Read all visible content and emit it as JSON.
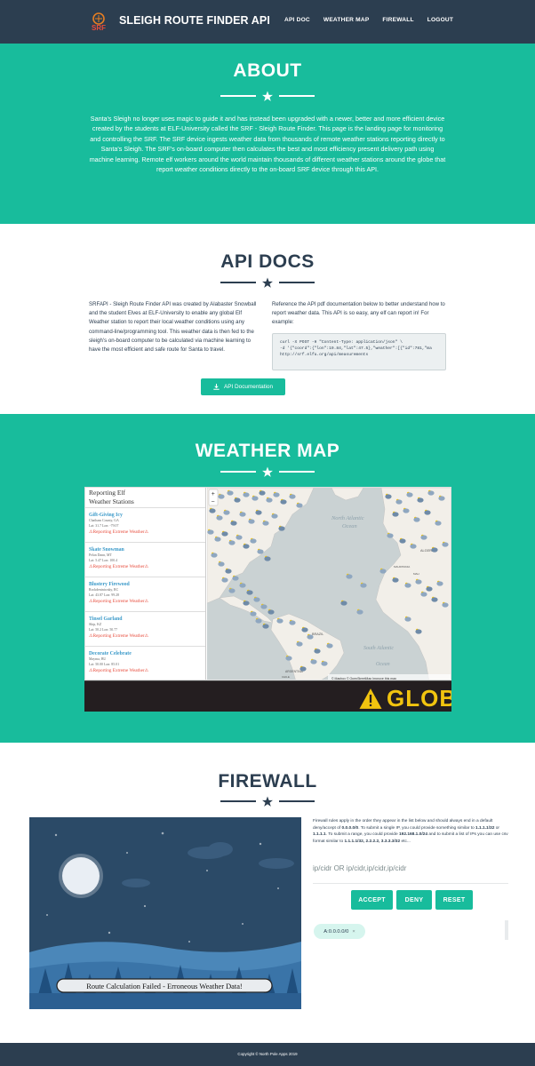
{
  "nav": {
    "brand": "SLEIGH ROUTE FINDER API",
    "logo_text": "SRF",
    "links": [
      "API DOC",
      "WEATHER MAP",
      "FIREWALL",
      "LOGOUT"
    ]
  },
  "about": {
    "title": "ABOUT",
    "text": "Santa's Sleigh no longer uses magic to guide it and has instead been upgraded with a newer, better and more efficient device created by the students at ELF-University called the SRF - Sleigh Route Finder. This page is the landing page for monitoring and controlling the SRF. The SRF device ingests weather data from thousands of remote weather stations reporting directly to Santa's Sleigh. The SRF's on-board computer then calculates the best and most efficiency present delivery path using machine learning. Remote elf workers around the world maintain thousands of different weather stations around the globe that report weather conditions directly to the on-board SRF device through this API."
  },
  "api_docs": {
    "title": "API DOCS",
    "left_text": "SRFAPI - Sleigh Route Finder API was created by Alabaster Snowball and the student Elves at ELF-University to enable any global Elf Weather station to report their local weather conditions using any command-line/programming tool. This weather data is then fed to the sleigh's on-board computer to be calculated via machine learning to have the most efficient and safe route for Santa to travel.",
    "right_text": "Reference the API pdf documentation below to better understand how to report weather data. This API is so easy, any elf can report in! For example:",
    "code_line1": "curl -X POST -H \"Content-Type: application/json\" \\",
    "code_line2": "-d '{\"coord\":{\"lon\":19.84,\"lat\":47.5},\"weather\":[{\"id\":781,\"ma",
    "code_line3": "http://srf.elfu.org/api/measurements",
    "button": "API Documentation"
  },
  "weather": {
    "title": "WEATHER MAP",
    "panel_title_1": "Reporting Elf",
    "panel_title_2": "Weather Stations",
    "stations": [
      {
        "name": "Gift-Giving Icy",
        "loc": "Chatham County, GA",
        "ll": "Lat: 31.7 Lon: -79.07",
        "warn": "⚠Reporting Extreme Weather⚠"
      },
      {
        "name": "Skate Snowman",
        "loc": "Pelan Dann, MT",
        "ll": "Lat: 5.47 Lon: 100.4",
        "warn": "⚠Reporting Extreme Weather⚠"
      },
      {
        "name": "Blustery Firewood",
        "loc": "Rockdeniniwaky, RC",
        "ll": "Lat: 43.87 Lon: 99.28",
        "warn": "⚠Reporting Extreme Weather⚠"
      },
      {
        "name": "Tinsel Garland",
        "loc": "Skip, KZ",
        "ll": "Lat: 50.2 Lon: 50.77",
        "warn": "⚠Reporting Extreme Weather⚠"
      },
      {
        "name": "Decorate Celebrate",
        "loc": "Mayma, BU",
        "ll": "Lat: 50.00 Lon: 85.01",
        "warn": "⚠Reporting Extreme Weather⚠"
      }
    ],
    "map_labels": {
      "ocean1_a": "North Atlantic",
      "ocean1_b": "Ocean",
      "ocean2_a": "South Atlantic",
      "ocean2_b": "Ocean",
      "algeria": "ALGERIA",
      "brazil": "BRAZIL",
      "argentina": "ARGENTINA",
      "chile": "CHILE",
      "mauritania": "MAURITANIA",
      "mali": "MALI",
      "attribution": "© Mapbox © OpenStreetMap Improve this map",
      "zoom_in": "+",
      "zoom_out": "−"
    },
    "ticker": "GLOBA"
  },
  "firewall": {
    "title": "FIREWALL",
    "status": "Route Calculation Failed - Erroneous Weather Data!",
    "desc_1": "Firewall rules apply in the order they appear in the list below and should always end in a default deny/accept of ",
    "desc_zero": "0.0.0.0/0",
    "desc_2": ". To submit a single IP, you could provide something similar to ",
    "desc_ip1": "1.1.1.1/32",
    "desc_3": " or ",
    "desc_ip2": "1.1.1.1",
    "desc_4": ". To submit a range, you could provide ",
    "desc_range": "192.168.1.0/24",
    "desc_5": " and to submit a list of IPs you can use csv format similar to ",
    "desc_list": "1.1.1.1/32, 2.2.2.2, 3.3.3.3/32",
    "desc_6": " etc...",
    "input_placeholder": "ip/cidr OR ip/cidr,ip/cidr,ip/cidr",
    "buttons": [
      "ACCEPT",
      "DENY",
      "RESET"
    ],
    "tag": "A:0.0.0.0/0",
    "tag_close": "×"
  },
  "footer": {
    "text": "Copyright © North Pole Apps 2019"
  },
  "colors": {
    "navy": "#2c3e50",
    "teal": "#18bc9c",
    "warning_red": "#e74c3c",
    "ticker_yellow": "#f1c40f"
  }
}
